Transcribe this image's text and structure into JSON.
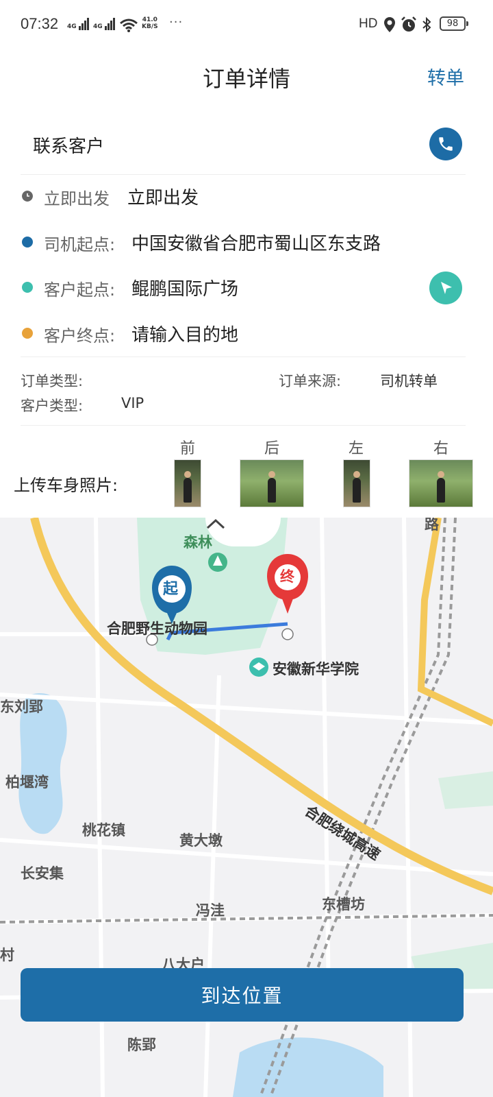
{
  "status_bar": {
    "time": "07:32",
    "signal1": "4G",
    "signal2": "4G",
    "net_speed_value": "41.0",
    "net_speed_unit": "KB/S",
    "more": "···",
    "hd": "HD",
    "battery": "98"
  },
  "header": {
    "title": "订单详情",
    "transfer": "转单"
  },
  "contact": {
    "label": "联系客户"
  },
  "rows": {
    "depart": {
      "key": "立即出发",
      "value": "立即出发",
      "color": "#666666"
    },
    "driver_start": {
      "key": "司机起点:",
      "value": "中国安徽省合肥市蜀山区东支路",
      "color": "#1d6ca6"
    },
    "customer_start": {
      "key": "客户起点:",
      "value": "鲲鹏国际广场",
      "color": "#3dbfae"
    },
    "customer_end": {
      "key": "客户终点:",
      "value": "请输入目的地",
      "color": "#e8a23a"
    }
  },
  "meta": {
    "order_type_label": "订单类型:",
    "order_type_value": "",
    "order_source_label": "订单来源:",
    "order_source_value": "司机转单",
    "customer_type_label": "客户类型:",
    "customer_type_value": "VIP"
  },
  "photos": {
    "title": "上传车身照片:",
    "front": "前",
    "back": "后",
    "left": "左",
    "right": "右"
  },
  "map": {
    "start_marker": "起",
    "end_marker": "终",
    "labels": {
      "zoo": "合肥野生动物园",
      "forest": "森林",
      "road": "路",
      "academy": "安徽新华学院",
      "dongliu": "东刘郢",
      "baiyanwan": "柏堰湾",
      "taohua": "桃花镇",
      "huangdadun": "黄大墩",
      "changanji": "长安集",
      "fengwa": "冯洼",
      "dongcaofang": "东槽坊",
      "cun": "村",
      "badahu": "八大户",
      "chenying": "陈郢",
      "highway": "合肥绕城高速"
    }
  },
  "actions": {
    "arrive": "到达位置"
  }
}
